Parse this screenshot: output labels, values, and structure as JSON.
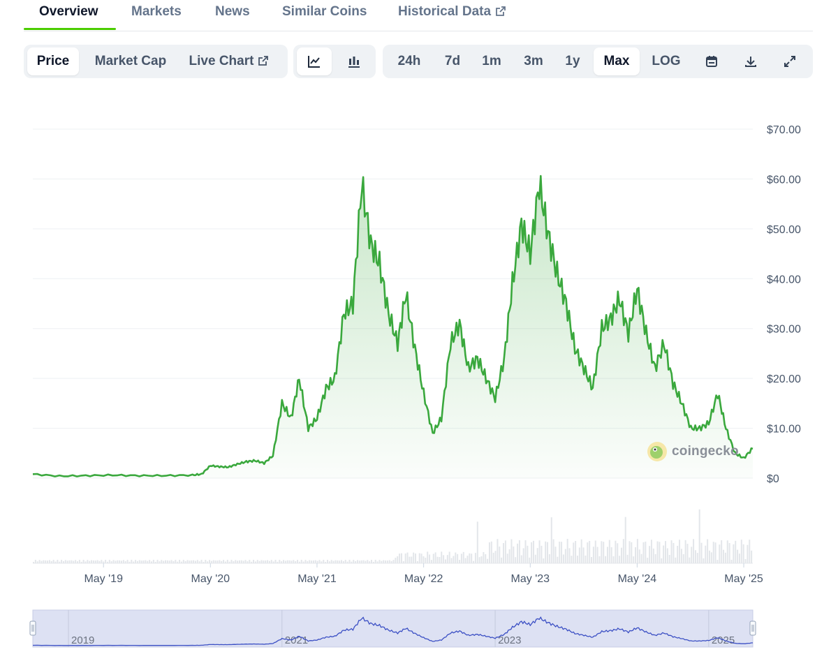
{
  "tabs": [
    {
      "label": "Overview",
      "active": true
    },
    {
      "label": "Markets",
      "active": false
    },
    {
      "label": "News",
      "active": false
    },
    {
      "label": "Similar Coins",
      "active": false
    },
    {
      "label": "Historical Data",
      "active": false,
      "icon": "external-link-icon"
    }
  ],
  "toolbar": {
    "metric": [
      {
        "label": "Price",
        "selected": true
      },
      {
        "label": "Market Cap",
        "selected": false
      },
      {
        "label": "Live Chart",
        "selected": false,
        "icon": "external-link-icon"
      }
    ],
    "chart_type": [
      {
        "icon": "line-chart-icon",
        "selected": true
      },
      {
        "icon": "candlestick-chart-icon",
        "selected": false
      }
    ],
    "ranges": [
      {
        "label": "24h",
        "selected": false
      },
      {
        "label": "7d",
        "selected": false
      },
      {
        "label": "1m",
        "selected": false
      },
      {
        "label": "3m",
        "selected": false
      },
      {
        "label": "1y",
        "selected": false
      },
      {
        "label": "Max",
        "selected": true
      },
      {
        "label": "LOG",
        "selected": false
      }
    ],
    "actions": [
      "calendar-icon",
      "download-icon",
      "fullscreen-icon"
    ]
  },
  "watermark": {
    "text": "coingecko",
    "icon": "coingecko-logo-icon"
  },
  "colors": {
    "line": "#3aa83d",
    "accent": "#4bcc00",
    "navigator_line": "#3b4fc4",
    "navigator_fill": "#dde1f3"
  },
  "chart_data": {
    "type": "area",
    "series": [
      {
        "x": [
          "2018-09",
          "2018-12",
          "2019-03",
          "2019-06",
          "2019-09",
          "2019-12",
          "2020-03",
          "2020-04",
          "2020-05",
          "2020-06",
          "2020-07",
          "2020-08",
          "2020-09",
          "2020-10",
          "2020-11",
          "2020-12",
          "2021-01",
          "2021-02",
          "2021-03",
          "2021-04",
          "2021-05",
          "2021-06",
          "2021-07",
          "2021-08",
          "2021-09",
          "2021-10",
          "2021-11",
          "2021-12",
          "2022-01",
          "2022-02",
          "2022-03",
          "2022-04",
          "2022-05",
          "2022-06",
          "2022-07",
          "2022-08",
          "2022-09",
          "2022-10",
          "2022-11",
          "2022-12",
          "2023-01",
          "2023-02",
          "2023-03",
          "2023-04",
          "2023-05",
          "2023-06",
          "2023-07",
          "2023-08",
          "2023-09",
          "2023-10",
          "2023-11",
          "2023-12",
          "2024-01",
          "2024-02",
          "2024-03",
          "2024-04",
          "2024-05",
          "2024-06",
          "2024-07",
          "2024-08",
          "2024-09",
          "2024-10",
          "2024-11",
          "2024-12",
          "2025-01",
          "2025-02",
          "2025-03",
          "2025-04",
          "2025-05",
          "2025-06"
        ],
        "values": [
          0.8,
          0.4,
          0.5,
          0.6,
          0.5,
          0.5,
          0.6,
          0.8,
          2.5,
          2.3,
          2.2,
          2.8,
          3.3,
          3.5,
          3.0,
          4.5,
          15.0,
          12.0,
          20.0,
          10.0,
          12.0,
          18.0,
          20.0,
          33.0,
          35.0,
          59.0,
          47.0,
          43.0,
          33.0,
          27.0,
          37.0,
          26.0,
          17.0,
          9.0,
          12.0,
          27.0,
          31.0,
          22.0,
          24.0,
          20.0,
          16.0,
          24.0,
          39.0,
          51.0,
          45.0,
          59.0,
          49.0,
          41.0,
          35.0,
          26.0,
          22.0,
          18.0,
          30.0,
          32.0,
          36.0,
          29.0,
          38.0,
          29.0,
          22.0,
          27.0,
          19.0,
          15.0,
          10.0,
          10.0,
          11.0,
          17.0,
          10.0,
          5.0,
          4.0,
          6.0
        ]
      }
    ],
    "y_ticks": [
      "$0",
      "$10.00",
      "$20.00",
      "$30.00",
      "$40.00",
      "$50.00",
      "$60.00",
      "$70.00"
    ],
    "ylim": [
      0,
      70
    ],
    "x_ticks": [
      "May '19",
      "May '20",
      "May '21",
      "May '22",
      "May '23",
      "May '24",
      "May '25"
    ],
    "navigator_ticks": [
      "2019",
      "2021",
      "2023",
      "2025"
    ],
    "grid": true
  }
}
